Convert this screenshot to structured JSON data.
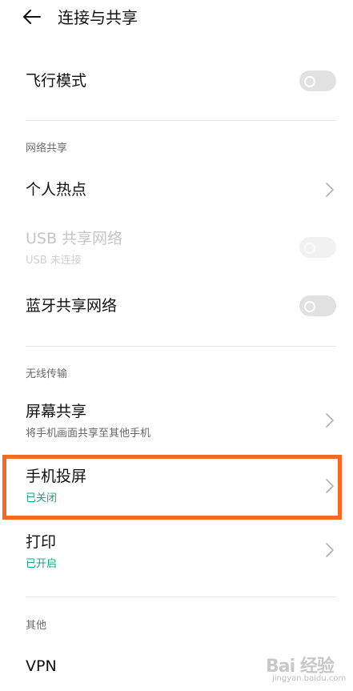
{
  "header": {
    "title": "连接与共享"
  },
  "airplane": {
    "label": "飞行模式"
  },
  "sections": {
    "network_share": "网络共享",
    "wireless": "无线传输",
    "other": "其他"
  },
  "items": {
    "hotspot": {
      "label": "个人热点"
    },
    "usb_share": {
      "label": "USB 共享网络",
      "sub": "USB 未连接"
    },
    "bluetooth_share": {
      "label": "蓝牙共享网络"
    },
    "screen_share": {
      "label": "屏幕共享",
      "sub": "将手机画面共享至其他手机"
    },
    "phone_cast": {
      "label": "手机投屏",
      "sub": "已关闭"
    },
    "print": {
      "label": "打印",
      "sub": "已开启"
    },
    "vpn": {
      "label": "VPN"
    }
  },
  "watermark": {
    "text": "Bai 经验",
    "sub": "jingyan.baidu.com"
  },
  "colors": {
    "accent_green": "#16a383",
    "highlight_orange": "#f26b21"
  }
}
